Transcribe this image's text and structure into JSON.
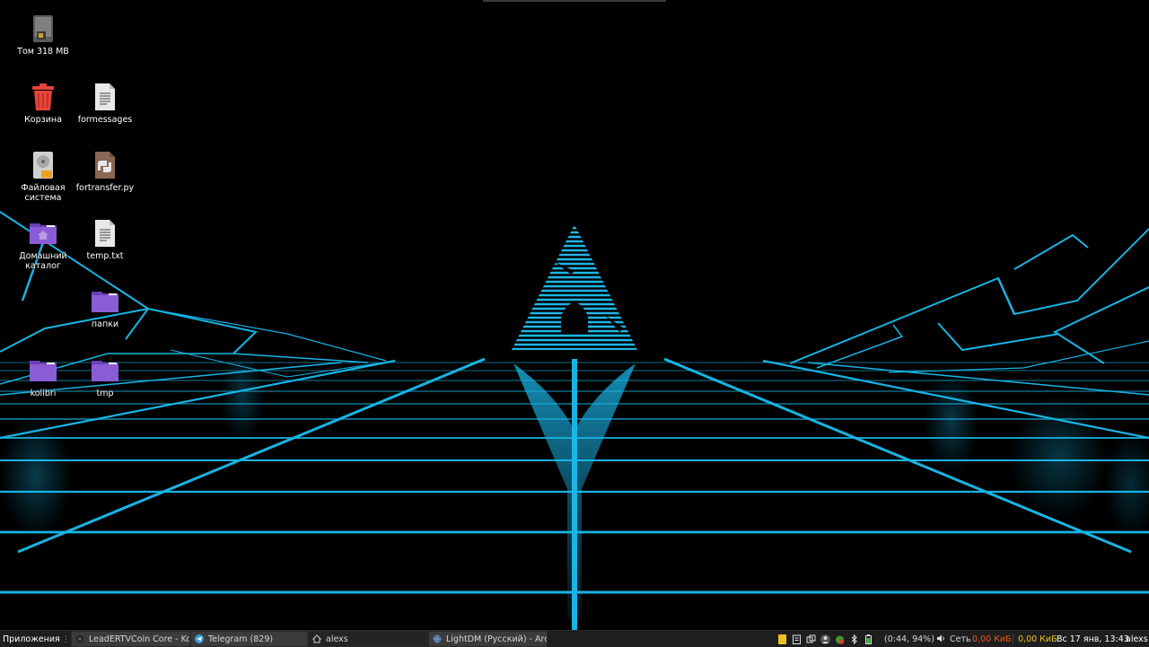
{
  "desktop": {
    "icons": [
      {
        "label": "Том 318 MB"
      },
      {
        "label": "Корзина"
      },
      {
        "label": "formessages"
      },
      {
        "label": "Файловая система"
      },
      {
        "label": "fortransfer.py"
      },
      {
        "label": "Домашний каталог"
      },
      {
        "label": "temp.txt"
      },
      {
        "label": "папки"
      },
      {
        "label": "kolibri"
      },
      {
        "label": "tmp"
      }
    ]
  },
  "taskbar": {
    "menu_label": "Приложения",
    "tasks": [
      {
        "label": "LeadERTVCoin Core - Ko..."
      },
      {
        "label": "Telegram (829)"
      },
      {
        "label": "alexs"
      },
      {
        "label": "LightDM (Русский) - Arc..."
      }
    ],
    "battery_text": "(0:44, 94%)",
    "network_label": "Сеть",
    "network_speed": "0,00 КиБ",
    "network_speed2": "0,00 КиБ",
    "clock": "Вс 17 янв, 13:43",
    "user": "alexs"
  },
  "colors": {
    "accent_neon": "#18b4e4",
    "trash_red": "#e8443a",
    "folder_purple": "#8a5cd6",
    "speed_orange": "#f05a1e",
    "speed_yellow": "#f0c020",
    "taskbar_bg": "#1e1e1e"
  }
}
